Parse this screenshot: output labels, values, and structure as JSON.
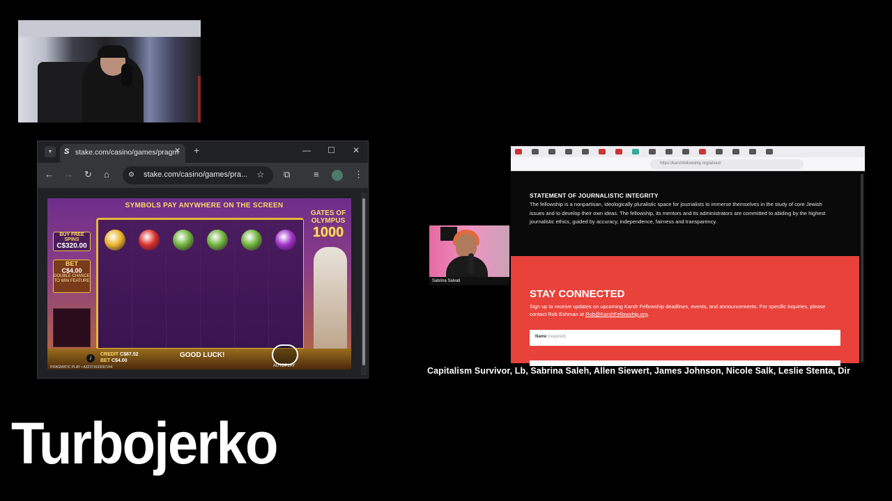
{
  "left_browser": {
    "tab_title": "stake.com/casino/games/pragm",
    "tab_favicon": "S",
    "url": "stake.com/casino/games/pra...",
    "icons": [
      "tabs-menu-icon",
      "close-icon",
      "new-tab-icon",
      "minimize-icon",
      "maximize-icon",
      "window-close-icon",
      "back-icon",
      "forward-icon",
      "reload-icon",
      "home-icon",
      "site-info-icon",
      "bookmark-star-icon",
      "extensions-icon",
      "media-icon",
      "profile-avatar",
      "more-menu-icon"
    ]
  },
  "slot": {
    "banner": "SYMBOLS PAY ANYWHERE ON THE SCREEN",
    "free_spins_label": "BUY FREE SPINS",
    "free_spins_amount": "C$320.00",
    "bet_title": "BET",
    "bet_value": "C$4.00",
    "bet_sub": "DOUBLE CHANCE TO WIN FEATURE",
    "olympus_title": "GATES OF OLYMPUS",
    "olympus_num": "1000",
    "credit_label": "CREDIT",
    "credit_value": "C$87.52",
    "bet_label": "BET",
    "bet_bottom_value": "C$4.00",
    "good_luck": "GOOD LUCK!",
    "autoplay": "AUTOPLAY",
    "info": "i",
    "footer": "PRAGMATIC PLAY • A32371633097244",
    "symbol_colors": [
      "#e9b526",
      "#d8322a",
      "#6fb33a",
      "#6fb33a",
      "#6fb33a",
      "#a032c8"
    ]
  },
  "right_browser": {
    "url": "https://karshfellowship.org/about/",
    "statement_title": "STATEMENT OF JOURNALISTIC INTEGRITY",
    "statement_body": "The fellowship is a nonpartisan, ideologically pluralistic space for journalists to immerse themselves in the study of core Jewish issues and to develop their own ideas. The fellowship, its mentors and its administrators are committed to abiding by the highest journalistic ethics, guided by accuracy, independence, fairness and transparency.",
    "stay_title": "STAY CONNECTED",
    "stay_body": "Sign up to receive updates on upcoming Karsh Fellowship deadlines, events, and announcements. For specific inquiries, please contact Rob Eshman at",
    "stay_link": "Rob@KarshFellowship.org",
    "stay_end": ".",
    "name_label": "Name",
    "name_required": "(required)",
    "guest_name": "Sabrina Salvati",
    "red_color": "#e8423b"
  },
  "ticker": "Capitalism Survivor, Lb, Sabrina Saleh, Allen Siewert, James Johnson, Nicole Salk, Leslie Stenta, Dir",
  "streamer_name": "Turbojerko"
}
